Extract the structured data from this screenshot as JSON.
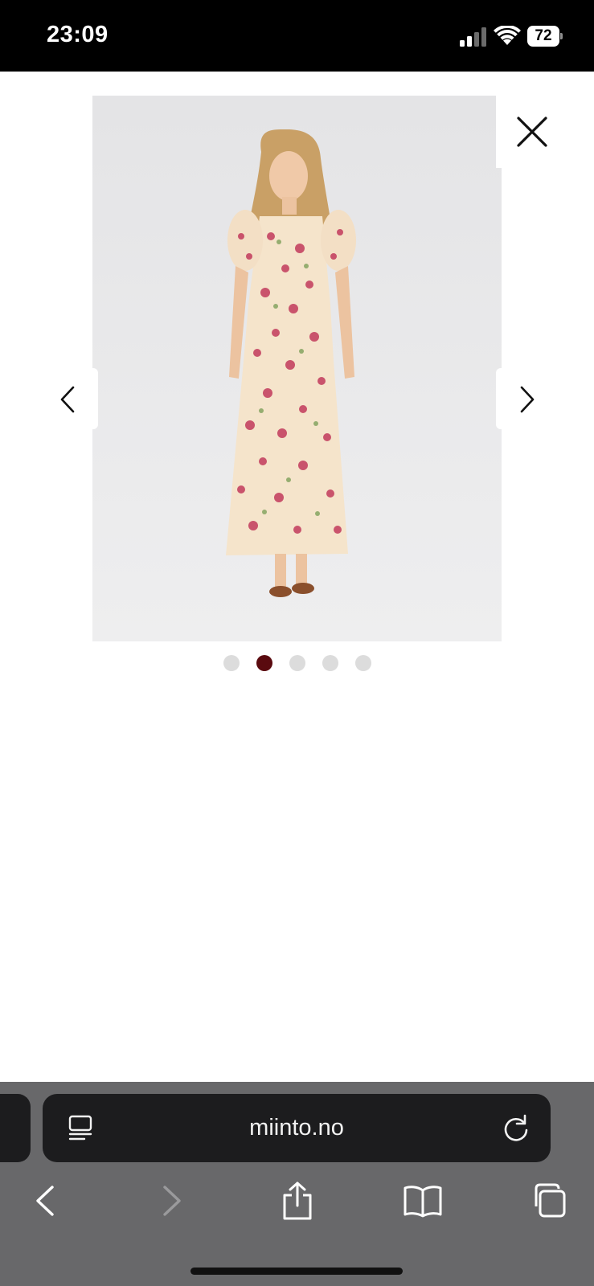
{
  "status_bar": {
    "time": "23:09",
    "battery": "72",
    "icons": [
      "cellular-signal-icon",
      "wifi-icon",
      "battery-icon"
    ]
  },
  "gallery": {
    "image_alt": "Woman wearing a cream floral maxi dress with puff sleeves",
    "total_images": 5,
    "active_index": 1,
    "icons": [
      "close-icon",
      "chevron-left-icon",
      "chevron-right-icon"
    ]
  },
  "browser": {
    "url": "miinto.no",
    "icons": [
      "page-menu-icon",
      "reload-icon",
      "back-icon",
      "forward-icon",
      "share-icon",
      "bookmarks-icon",
      "tabs-icon"
    ]
  },
  "colors": {
    "active_dot": "#5a0a0f",
    "inactive_dot": "#dcdcdc",
    "browser_chrome": "#68686a",
    "url_bar": "#1c1c1e"
  }
}
